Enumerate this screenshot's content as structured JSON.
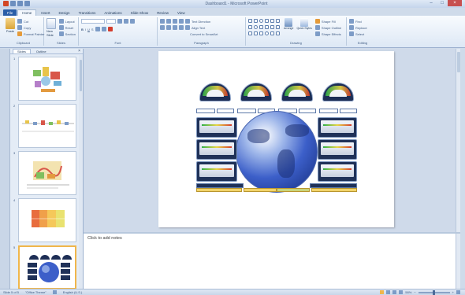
{
  "window": {
    "title": "Dashboard1 - Microsoft PowerPoint"
  },
  "ribbon": {
    "tabs": [
      "File",
      "Home",
      "Insert",
      "Design",
      "Transitions",
      "Animations",
      "Slide Show",
      "Review",
      "View"
    ],
    "active_tab": "Home",
    "groups": {
      "clipboard": {
        "label": "Clipboard",
        "paste": "Paste",
        "cut": "Cut",
        "copy": "Copy",
        "format_painter": "Format Painter"
      },
      "slides": {
        "label": "Slides",
        "new_slide": "New Slide",
        "layout": "Layout",
        "reset": "Reset",
        "section": "Section"
      },
      "font": {
        "label": "Font"
      },
      "paragraph": {
        "label": "Paragraph",
        "text_direction": "Text Direction",
        "align_text": "Align Text",
        "convert_smartart": "Convert to SmartArt"
      },
      "drawing": {
        "label": "Drawing",
        "arrange": "Arrange",
        "quick_styles": "Quick Styles",
        "shape_fill": "Shape Fill",
        "shape_outline": "Shape Outline",
        "shape_effects": "Shape Effects"
      },
      "editing": {
        "label": "Editing",
        "find": "Find",
        "replace": "Replace",
        "select": "Select"
      }
    }
  },
  "left_panel": {
    "tabs": [
      "Slides",
      "Outline"
    ],
    "active_tab": "Slides",
    "close_glyph": "×",
    "slide_numbers": [
      "1",
      "2",
      "3",
      "4",
      "5"
    ],
    "selected_slide": 5
  },
  "notes": {
    "placeholder": "Click to add notes"
  },
  "statusbar": {
    "slide_info": "Slide 5 of 5",
    "theme": "\"Office Theme\"",
    "language": "English (U.S.)",
    "zoom": "58%"
  },
  "icons": {
    "minimize": "minimize-icon",
    "maximize": "maximize-icon",
    "close": "close-icon"
  },
  "colors": {
    "file_tab": "#2a5ea8",
    "selected_thumb": "#f0b64b",
    "globe": "#3c5fc9",
    "gauge_body": "#1d2e55"
  }
}
